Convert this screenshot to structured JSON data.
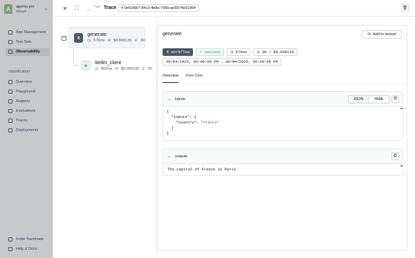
{
  "sidebar": {
    "workspace": {
      "avatar_letter": "A",
      "name": "agenta-pro",
      "sub": "default"
    },
    "top_items": [
      {
        "label": "App Management"
      },
      {
        "label": "Test Sets"
      },
      {
        "label": "Observability"
      }
    ],
    "section_label": "classification",
    "app_items": [
      {
        "label": "Overview"
      },
      {
        "label": "Playground"
      },
      {
        "label": "Registry"
      },
      {
        "label": "Evaluations"
      },
      {
        "label": "Traces"
      },
      {
        "label": "Deployments"
      }
    ],
    "bottom_items": [
      {
        "label": "Invite Teammate"
      },
      {
        "label": "Help & Docs"
      }
    ]
  },
  "topbar": {
    "title": "Trace",
    "trace_id": "# 0ef1d6b7-84c3-4b8a-705b-ae5974e51954"
  },
  "tree": {
    "root": {
      "name": "generate",
      "duration": "576ms",
      "cost": "$0.000135",
      "tokens": "30"
    },
    "child": {
      "name": "litellm_client",
      "duration": "562ms",
      "cost": "$0.000135",
      "tokens": "30"
    }
  },
  "detail": {
    "title": "generate",
    "add_button": "Add to testset",
    "tags": {
      "type": "workflow",
      "status": "success",
      "duration": "576ms",
      "tokens_cost": "30 / $0.000135"
    },
    "time_range": "30/04/2025, 05:00:05 PM → 30/04/2025, 05:00:05 PM",
    "tabs": [
      {
        "label": "Overview"
      },
      {
        "label": "Raw Data"
      }
    ],
    "inputs": {
      "label": "inputs",
      "format_options": [
        "JSON",
        "YAML"
      ],
      "code": {
        "l1": "{",
        "key_inputs": "\"inputs\"",
        "colon_brace": ": {",
        "key_country": "\"country\"",
        "colon": ": ",
        "val_country": "\"France\"",
        "l4": "}",
        "l5": "}"
      }
    },
    "outputs": {
      "label": "outputs",
      "text": "The capital of France is Paris."
    }
  },
  "colors": {
    "accent": "#4b5563",
    "success": "#2f8f57",
    "string": "#3b5bb5"
  }
}
